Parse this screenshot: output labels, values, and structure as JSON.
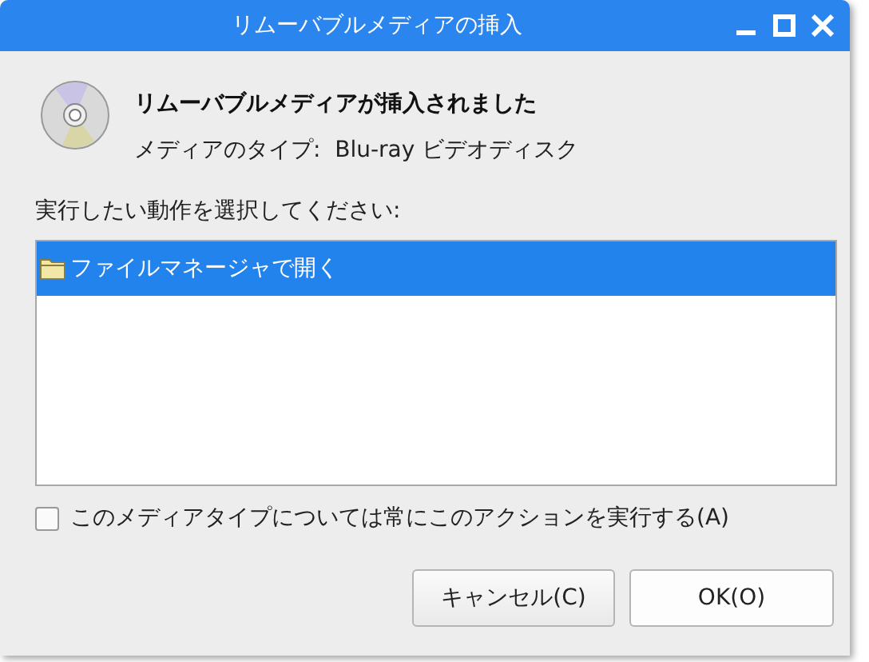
{
  "window": {
    "title": "リムーバブルメディアの挿入"
  },
  "header": {
    "title": "リムーバブルメディアが挿入されました",
    "media_type": "メディアのタイプ:  Blu-ray ビデオディスク"
  },
  "prompt": "実行したい動作を選択してください:",
  "actions": [
    {
      "label": "ファイルマネージャで開く",
      "selected": true
    }
  ],
  "always_checkbox": {
    "label": "このメディアタイプについては常にこのアクションを実行する(A)",
    "checked": false
  },
  "buttons": [
    {
      "label": "キャンセル(C)",
      "kind": "cancel"
    },
    {
      "label": "OK(O)",
      "kind": "ok"
    }
  ]
}
